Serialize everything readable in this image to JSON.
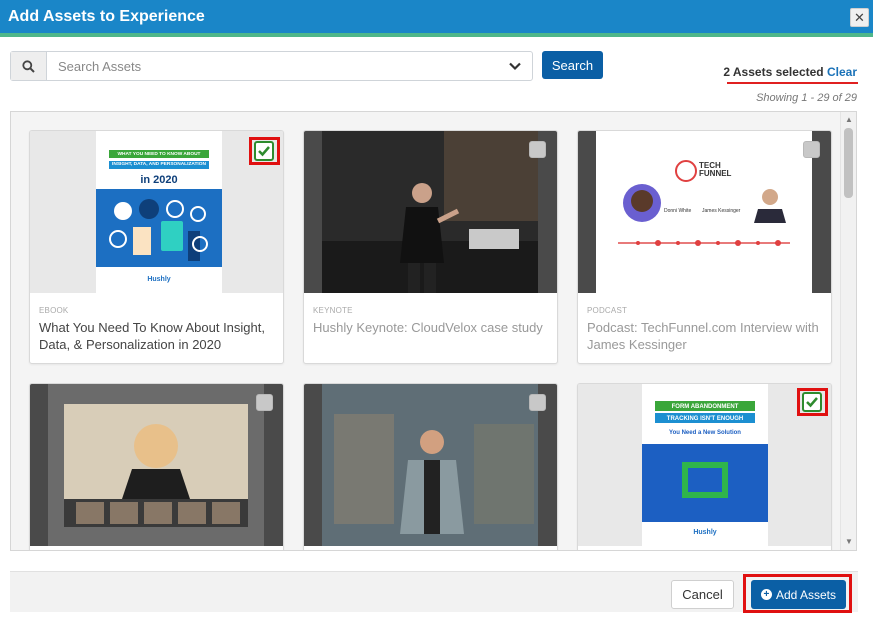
{
  "dialog": {
    "title": "Add Assets to Experience",
    "close_icon": "close-icon"
  },
  "search": {
    "placeholder": "Search Assets",
    "value": "",
    "button_label": "Search"
  },
  "selection": {
    "count_text": "2 Assets selected",
    "clear_label": "Clear",
    "showing_text": "Showing 1 - 29 of 29"
  },
  "assets": [
    {
      "type": "EBOOK",
      "title": "What You Need To Know About Insight, Data, & Personalization in 2020",
      "selected": true,
      "thumb": {
        "banner": "WHAT YOU NEED TO KNOW ABOUT INSIGHT, DATA, AND PERSONALIZATION",
        "year": "in 2020",
        "brand": "Hushly"
      }
    },
    {
      "type": "KEYNOTE",
      "title": "Hushly Keynote: CloudVelox case study",
      "selected": false
    },
    {
      "type": "PODCAST",
      "title": "Podcast: TechFunnel.com Interview with James Kessinger",
      "selected": false,
      "thumb": {
        "logo_line1": "TECH",
        "logo_line2": "FUNNEL",
        "guest1": "Donni White",
        "guest2": "James Kessinger"
      }
    },
    {
      "type": "",
      "title": "",
      "selected": false
    },
    {
      "type": "",
      "title": "",
      "selected": false
    },
    {
      "type": "",
      "title": "",
      "selected": true,
      "thumb": {
        "line1": "FORM ABANDONMENT",
        "line2": "TRACKING ISN'T ENOUGH",
        "subtitle": "You Need a New Solution",
        "brand": "Hushly"
      }
    }
  ],
  "footer": {
    "cancel_label": "Cancel",
    "add_label": "Add Assets"
  },
  "colors": {
    "header": "#1a86c8",
    "header_accent": "#4fb78a",
    "primary_button": "#0b5fa5",
    "highlight_red": "#e01010",
    "check_green": "#2e8b2e"
  }
}
